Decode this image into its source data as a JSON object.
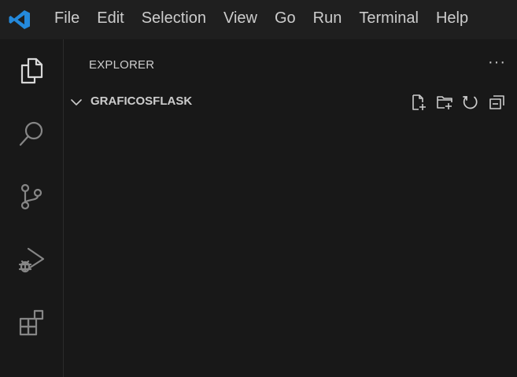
{
  "menubar": {
    "logo_icon": "vscode-logo-icon",
    "items": [
      {
        "label": "File"
      },
      {
        "label": "Edit"
      },
      {
        "label": "Selection"
      },
      {
        "label": "View"
      },
      {
        "label": "Go"
      },
      {
        "label": "Run"
      },
      {
        "label": "Terminal"
      },
      {
        "label": "Help"
      }
    ]
  },
  "activitybar": {
    "items": [
      {
        "name": "explorer",
        "icon": "files-icon",
        "active": true
      },
      {
        "name": "search",
        "icon": "search-icon",
        "active": false
      },
      {
        "name": "source-control",
        "icon": "source-control-icon",
        "active": false
      },
      {
        "name": "run-and-debug",
        "icon": "run-debug-icon",
        "active": false
      },
      {
        "name": "extensions",
        "icon": "extensions-icon",
        "active": false
      }
    ]
  },
  "sidebar": {
    "title": "EXPLORER",
    "more_actions": "···",
    "folder": {
      "name": "GRAFICOSFLASK",
      "expanded": true,
      "actions": [
        "new-file-icon",
        "new-folder-icon",
        "refresh-icon",
        "collapse-all-icon"
      ]
    }
  },
  "colors": {
    "background": "#181818",
    "menubar": "#1f1f1f",
    "logo_blue": "#2489db",
    "text": "#cccccc",
    "icon_active": "#d7d7d7",
    "icon_inactive": "#868686"
  }
}
